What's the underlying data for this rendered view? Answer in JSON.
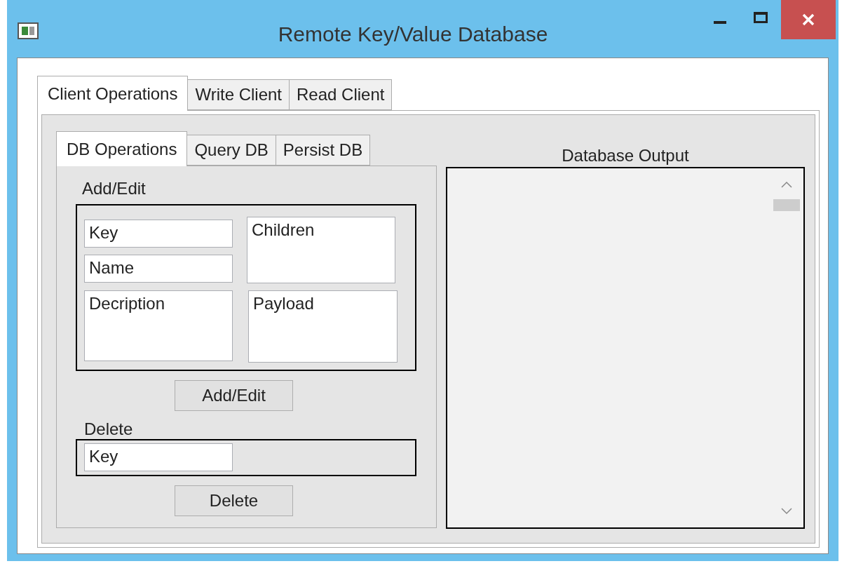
{
  "window": {
    "title": "Remote Key/Value Database"
  },
  "tabs": [
    {
      "label": "Client Operations",
      "selected": true
    },
    {
      "label": "Write Client",
      "selected": false
    },
    {
      "label": "Read Client",
      "selected": false
    }
  ],
  "sub_tabs": [
    {
      "label": "DB Operations",
      "selected": true
    },
    {
      "label": "Query DB",
      "selected": false
    },
    {
      "label": "Persist DB",
      "selected": false
    }
  ],
  "add_edit": {
    "title": "Add/Edit",
    "key": "Key",
    "name": "Name",
    "description": "Decription",
    "children": "Children",
    "payload": "Payload",
    "button": "Add/Edit"
  },
  "delete": {
    "title": "Delete",
    "key": "Key",
    "button": "Delete"
  },
  "output": {
    "title": "Database Output"
  }
}
